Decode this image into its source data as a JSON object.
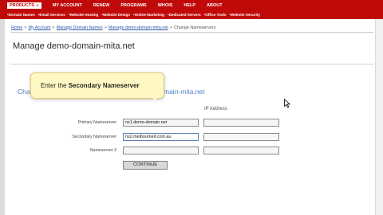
{
  "nav": {
    "primary": [
      {
        "label": "PRODUCTS",
        "has_caret": true,
        "active": true
      },
      {
        "label": "MY ACCOUNT"
      },
      {
        "label": "RENEW"
      },
      {
        "label": "PROGRAMS"
      },
      {
        "label": "WHOIS"
      },
      {
        "label": "HELP"
      },
      {
        "label": "ABOUT"
      }
    ],
    "secondary": [
      "•Domain Names",
      "•Email Services",
      "•Website Hosting",
      "•Website Design",
      "•Online Marketing",
      "•Dedicated Servers",
      "•Office Tools",
      "•Website Security"
    ]
  },
  "breadcrumb": {
    "home": "Home",
    "account": "My Account",
    "manage_domains": "Manage Domain Names",
    "domain": "Manage demo-domain-mita.net",
    "current": "Change Nameservers",
    "separator": ">"
  },
  "page_title": "Manage demo-domain-mita.net",
  "section": {
    "title_start": "Chang",
    "title_end": "main-mita.net"
  },
  "form": {
    "ip_header": "IP Address",
    "primary": {
      "label": "Primary Nameserver",
      "value": "ns1.demo-domain.net",
      "ip": ""
    },
    "secondary": {
      "label": "Secondary Nameserver",
      "value": "ns2.melbourneit.com.au",
      "ip": ""
    },
    "third": {
      "label": "Nameserver 3",
      "value": "",
      "ip": ""
    },
    "continue_label": "CONTINUE"
  },
  "callout": {
    "prefix": "Enter the ",
    "bold": "Secondary Nameserver"
  },
  "colors": {
    "nav_red": "#c00a0a",
    "link_blue": "#2a57a8",
    "section_blue": "#4a7ec2",
    "callout_bg": "#fff8c4"
  }
}
